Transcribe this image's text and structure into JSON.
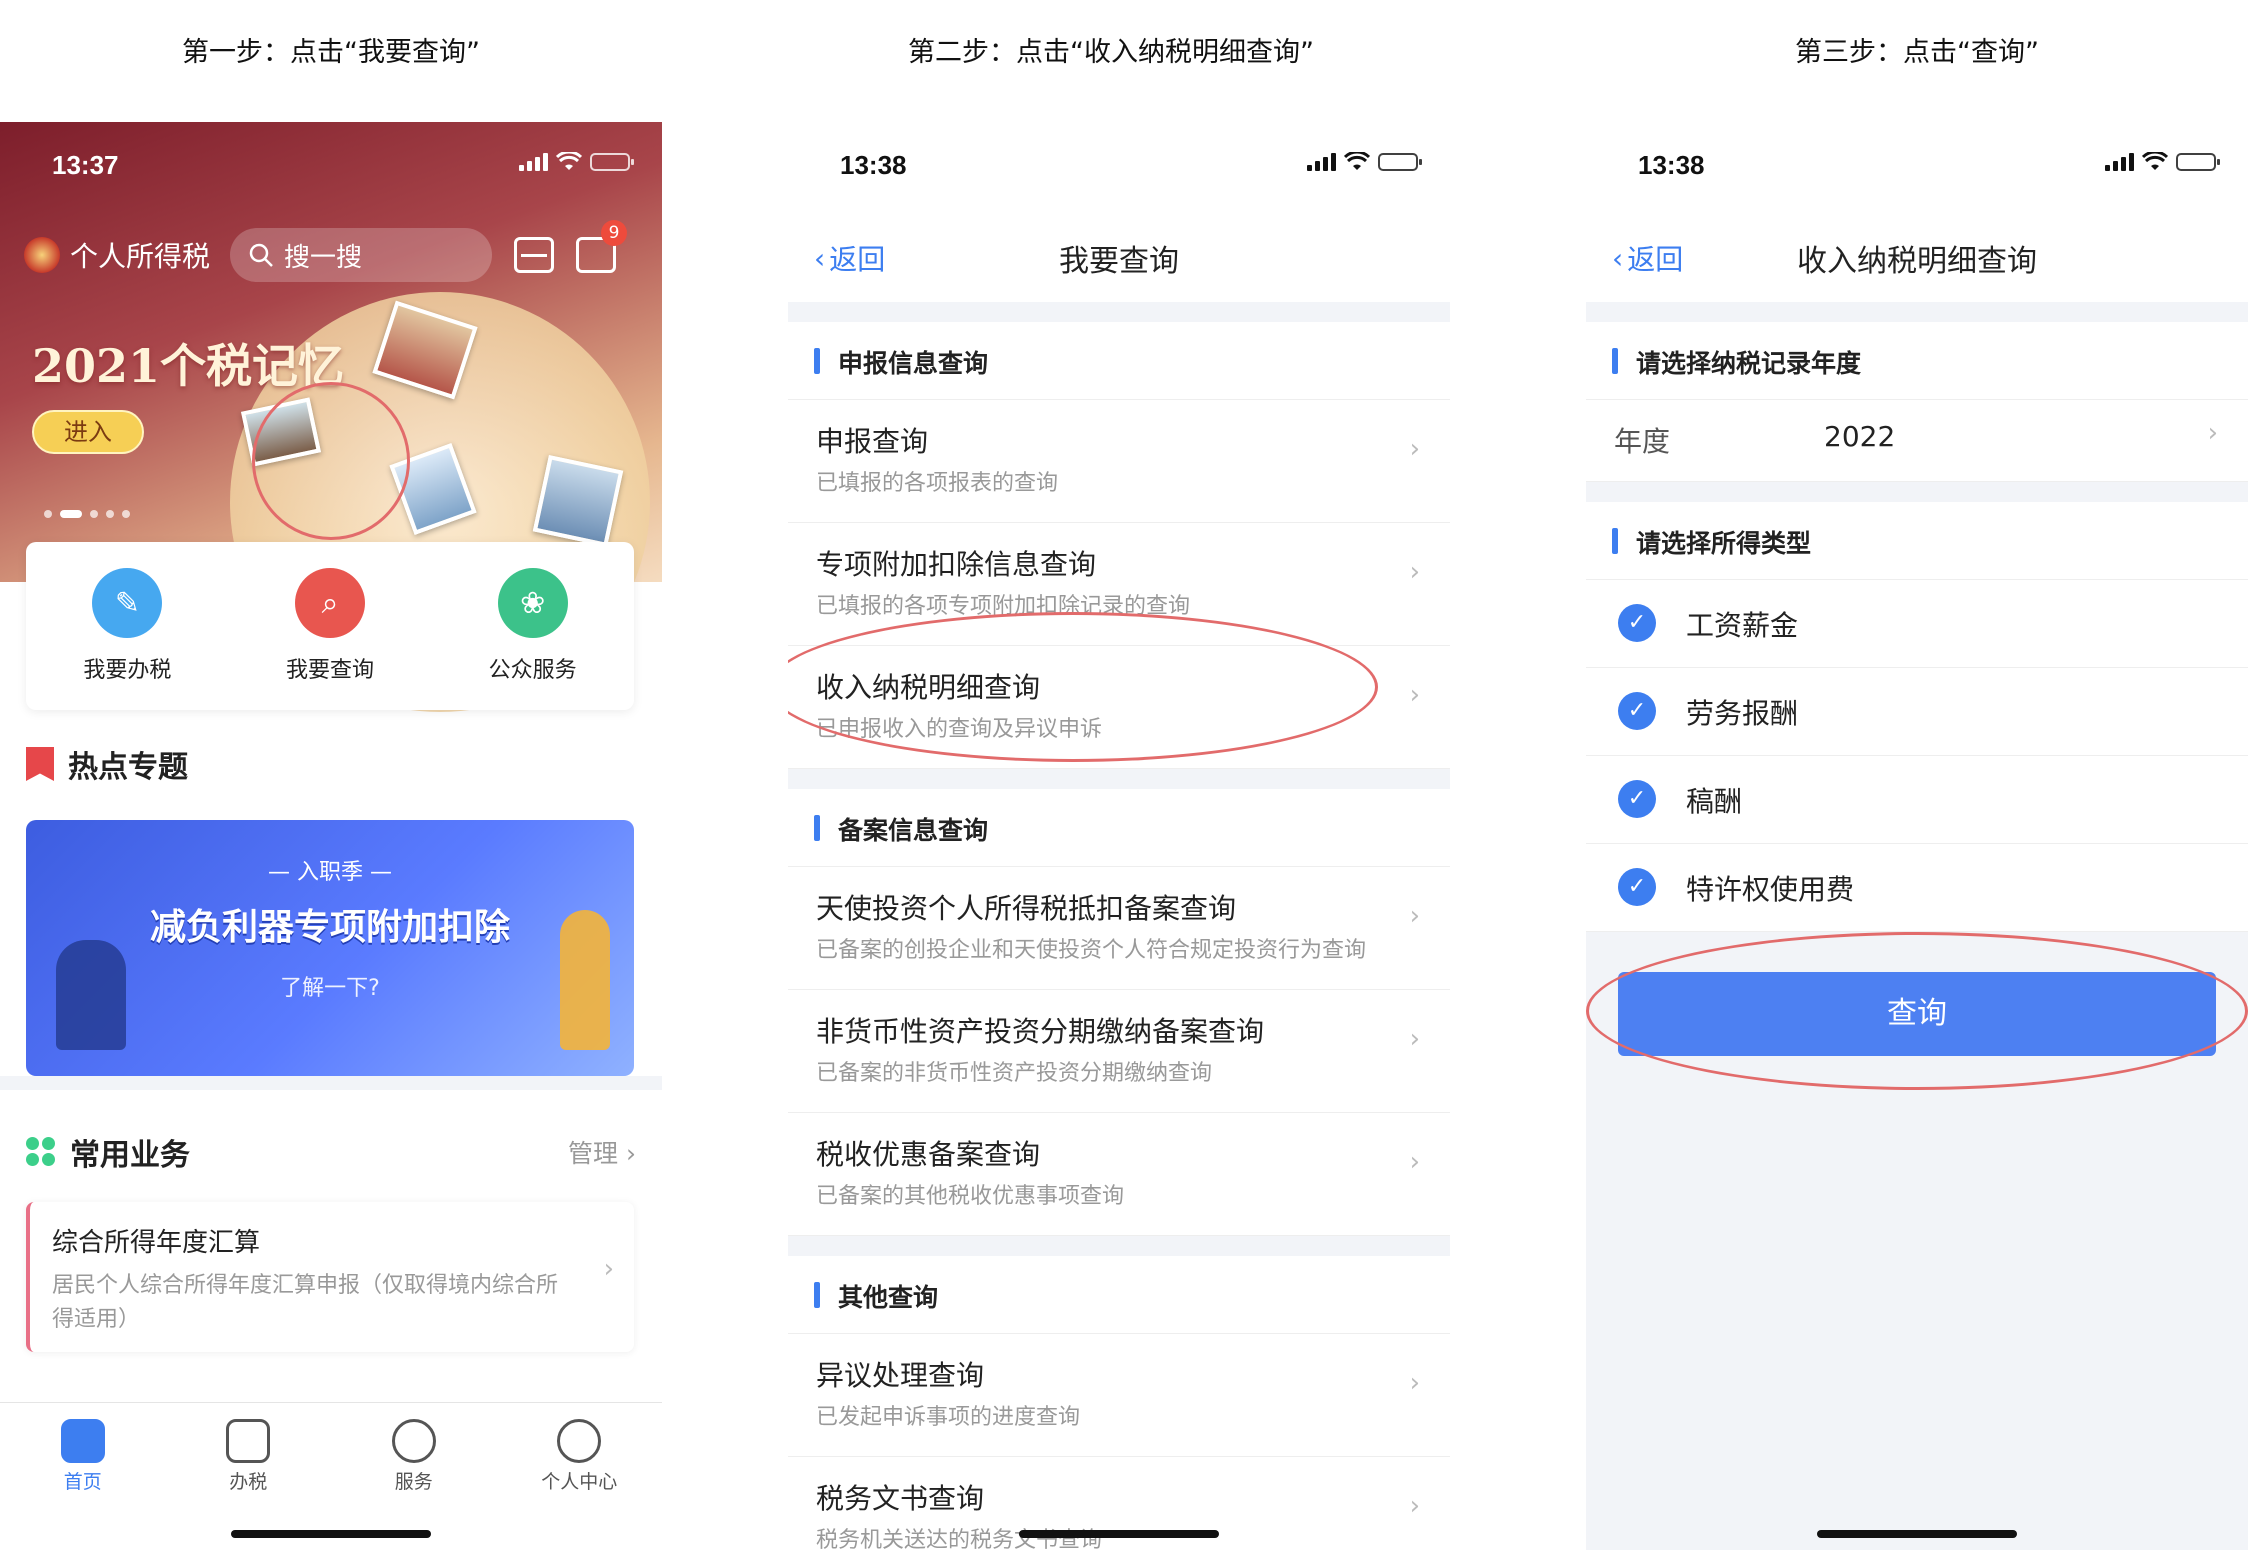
{
  "captions": [
    "第一步：点击“我要查询”",
    "第二步：点击“收入纳税明细查询”",
    "第三步：点击“查询”"
  ],
  "icons": {
    "signal": "signal-icon",
    "wifi": "wifi-icon",
    "battery": "battery-icon",
    "back": "chevron-left-icon",
    "chevron": "chevron-right-icon",
    "check": "check-circle-icon"
  },
  "colors": {
    "accent": "#3d7ef0",
    "highlight_ring": "#e26b6b",
    "badge": "#ee4b3c"
  },
  "screen1": {
    "time": "13:37",
    "app_name": "个人所得税",
    "search_placeholder": "搜一搜",
    "message_badge": "9",
    "hero_title": "2021个税记忆",
    "hero_button": "进入",
    "quick_actions": [
      {
        "label": "我要办税",
        "color": "#46a8f0"
      },
      {
        "label": "我要查询",
        "color": "#e8564f"
      },
      {
        "label": "公众服务",
        "color": "#3cc28a"
      }
    ],
    "hot_topics_title": "热点专题",
    "banner": {
      "top": "入职季",
      "main": "减负利器专项附加扣除",
      "bottom": "了解一下?"
    },
    "common_title": "常用业务",
    "manage": "管理",
    "card": {
      "title": "综合所得年度汇算",
      "desc": "居民个人综合所得年度汇算申报（仅取得境内综合所得适用）"
    },
    "tabs": [
      {
        "label": "首页",
        "active": true
      },
      {
        "label": "办税",
        "active": false
      },
      {
        "label": "服务",
        "active": false
      },
      {
        "label": "个人中心",
        "active": false
      }
    ]
  },
  "screen2": {
    "time": "13:38",
    "back": "返回",
    "title": "我要查询",
    "sections": [
      {
        "title": "申报信息查询",
        "items": [
          {
            "title": "申报查询",
            "desc": "已填报的各项报表的查询"
          },
          {
            "title": "专项附加扣除信息查询",
            "desc": "已填报的各项专项附加扣除记录的查询"
          },
          {
            "title": "收入纳税明细查询",
            "desc": "已申报收入的查询及异议申诉"
          }
        ]
      },
      {
        "title": "备案信息查询",
        "items": [
          {
            "title": "天使投资个人所得税抵扣备案查询",
            "desc": "已备案的创投企业和天使投资个人符合规定投资行为查询"
          },
          {
            "title": "非货币性资产投资分期缴纳备案查询",
            "desc": "已备案的非货币性资产投资分期缴纳查询"
          },
          {
            "title": "税收优惠备案查询",
            "desc": "已备案的其他税收优惠事项查询"
          }
        ]
      },
      {
        "title": "其他查询",
        "items": [
          {
            "title": "异议处理查询",
            "desc": "已发起申诉事项的进度查询"
          },
          {
            "title": "税务文书查询",
            "desc": "税务机关送达的税务文书查询"
          }
        ]
      }
    ]
  },
  "screen3": {
    "time": "13:38",
    "back": "返回",
    "title": "收入纳税明细查询",
    "year_section": "请选择纳税记录年度",
    "year_label": "年度",
    "year_value": "2022",
    "type_section": "请选择所得类型",
    "types": [
      "工资薪金",
      "劳务报酬",
      "稿酬",
      "特许权使用费"
    ],
    "query_button": "查询"
  }
}
